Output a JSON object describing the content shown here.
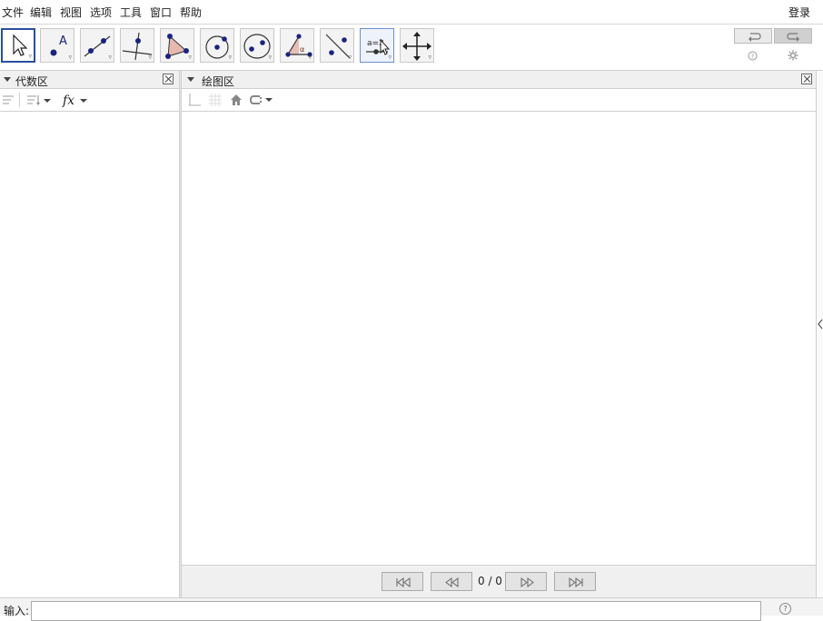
{
  "menu": {
    "items": [
      "文件",
      "编辑",
      "视图",
      "选项",
      "工具",
      "窗口",
      "帮助"
    ],
    "login": "登录"
  },
  "toolbar": {
    "tools": [
      {
        "name": "move-tool",
        "icon": "arrow-cursor-icon"
      },
      {
        "name": "point-tool",
        "icon": "point-a-icon"
      },
      {
        "name": "line-tool",
        "icon": "line-through-points-icon"
      },
      {
        "name": "perpendicular-line-tool",
        "icon": "perpendicular-line-icon"
      },
      {
        "name": "polygon-tool",
        "icon": "polygon-icon"
      },
      {
        "name": "circle-center-point-tool",
        "icon": "circle-center-icon"
      },
      {
        "name": "conic-tool",
        "icon": "ellipse-icon"
      },
      {
        "name": "angle-tool",
        "icon": "angle-icon"
      },
      {
        "name": "reflect-tool",
        "icon": "reflect-line-icon"
      },
      {
        "name": "slider-tool",
        "icon": "slider-icon"
      },
      {
        "name": "move-graphics-tool",
        "icon": "move-cross-icon"
      }
    ],
    "point_label": "A",
    "slider_label": "a=2",
    "angle_label": "α"
  },
  "algebra": {
    "title": "代数区"
  },
  "graphics": {
    "title": "绘图区"
  },
  "nav": {
    "count": "0 / 0"
  },
  "input": {
    "label": "输入:",
    "value": "",
    "help": "?"
  },
  "colors": {
    "accent": "#2a4ea0",
    "point": "#1a237e",
    "polygon_fill": "#e6b8b0"
  }
}
